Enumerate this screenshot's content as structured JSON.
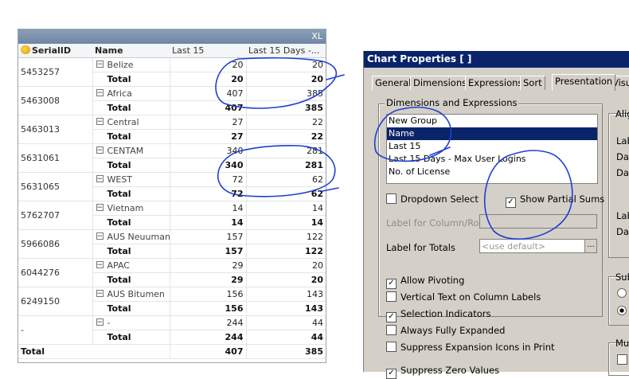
{
  "pivot": {
    "badge": "XL",
    "headers": {
      "serial": "SerialID",
      "name": "Name",
      "last15": "Last 15",
      "last15days": "Last 15 Days -..."
    },
    "groups": [
      {
        "serial": "5453257",
        "name": "Belize",
        "v1": "20",
        "v2": "20",
        "total_label": "Total",
        "t1": "20",
        "t2": "20"
      },
      {
        "serial": "5463008",
        "name": "Africa",
        "v1": "407",
        "v2": "385",
        "total_label": "Total",
        "t1": "407",
        "t2": "385"
      },
      {
        "serial": "5463013",
        "name": "Central",
        "v1": "27",
        "v2": "22",
        "total_label": "Total",
        "t1": "27",
        "t2": "22"
      },
      {
        "serial": "5631061",
        "name": "CENTAM",
        "v1": "340",
        "v2": "281",
        "total_label": "Total",
        "t1": "340",
        "t2": "281"
      },
      {
        "serial": "5631065",
        "name": "WEST",
        "v1": "72",
        "v2": "62",
        "total_label": "Total",
        "t1": "72",
        "t2": "62"
      },
      {
        "serial": "5762707",
        "name": "Vietnam",
        "v1": "14",
        "v2": "14",
        "total_label": "Total",
        "t1": "14",
        "t2": "14"
      },
      {
        "serial": "5966086",
        "name": "AUS Neuuman",
        "v1": "157",
        "v2": "122",
        "total_label": "Total",
        "t1": "157",
        "t2": "122"
      },
      {
        "serial": "6044276",
        "name": "APAC",
        "v1": "29",
        "v2": "20",
        "total_label": "Total",
        "t1": "29",
        "t2": "20"
      },
      {
        "serial": "6249150",
        "name": "AUS Bitumen",
        "v1": "156",
        "v2": "143",
        "total_label": "Total",
        "t1": "156",
        "t2": "143"
      },
      {
        "serial": "-",
        "name": "-",
        "v1": "244",
        "v2": "44",
        "total_label": "Total",
        "t1": "244",
        "t2": "44"
      }
    ],
    "grand": {
      "label": "Total",
      "v1": "407",
      "v2": "385"
    }
  },
  "dialog": {
    "title": "Chart Properties [ ]",
    "tabs": [
      "General",
      "Dimensions",
      "Expressions",
      "Sort",
      "Presentation",
      "Visu"
    ],
    "group_label": "Dimensions and Expressions",
    "list_items": [
      "New Group",
      "Name",
      "Last 15",
      "Last 15 Days - Max User Logins",
      "No. of License"
    ],
    "selected_item": "Name",
    "dropdown_select": "Dropdown Select",
    "show_partial_sums": "Show Partial Sums",
    "label_for_column_row": "Label for Column/Row",
    "label_for_totals": "Label for Totals",
    "totals_placeholder": "<use default>",
    "ellipsis": "...",
    "options": [
      {
        "label": "Allow Pivoting",
        "checked": true
      },
      {
        "label": "Vertical Text on Column Labels",
        "checked": false
      },
      {
        "label": "Selection Indicators",
        "checked": true
      },
      {
        "label": "Always Fully Expanded",
        "checked": false
      },
      {
        "label": "Suppress Expansion Icons in Print",
        "checked": false
      },
      {
        "label": "Suppress Zero Values",
        "checked": true
      }
    ],
    "right_col": {
      "ali": "Alig",
      "lab": "Lab",
      "dat": "Dat",
      "dat2": "Dat",
      "lab2": "Lab",
      "dat3": "Dat",
      "sub": "Sub",
      "mu": "Mu"
    }
  }
}
